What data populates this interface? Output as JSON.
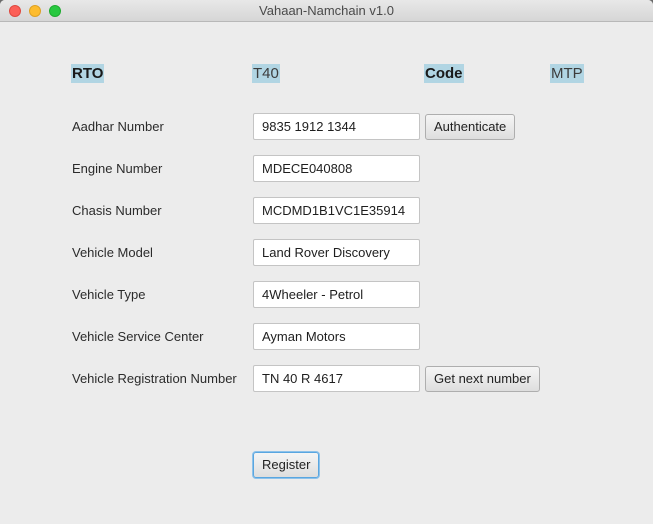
{
  "window": {
    "title": "Vahaan-Namchain v1.0"
  },
  "header": {
    "rto_label": "RTO",
    "rto_value": "T40",
    "code_label": "Code",
    "code_value": "MTP"
  },
  "form": {
    "fields": [
      {
        "label": "Aadhar Number",
        "value": "9835 1912 1344"
      },
      {
        "label": "Engine Number",
        "value": "MDECE040808"
      },
      {
        "label": "Chasis Number",
        "value": "MCDMD1B1VC1E35914"
      },
      {
        "label": "Vehicle Model",
        "value": "Land Rover Discovery"
      },
      {
        "label": "Vehicle Type",
        "value": "4Wheeler - Petrol"
      },
      {
        "label": "Vehicle Service Center",
        "value": "Ayman Motors"
      },
      {
        "label": "Vehicle Registration Number",
        "value": "TN 40 R 4617"
      }
    ],
    "authenticate_label": "Authenticate",
    "next_number_label": "Get next number",
    "register_label": "Register"
  }
}
